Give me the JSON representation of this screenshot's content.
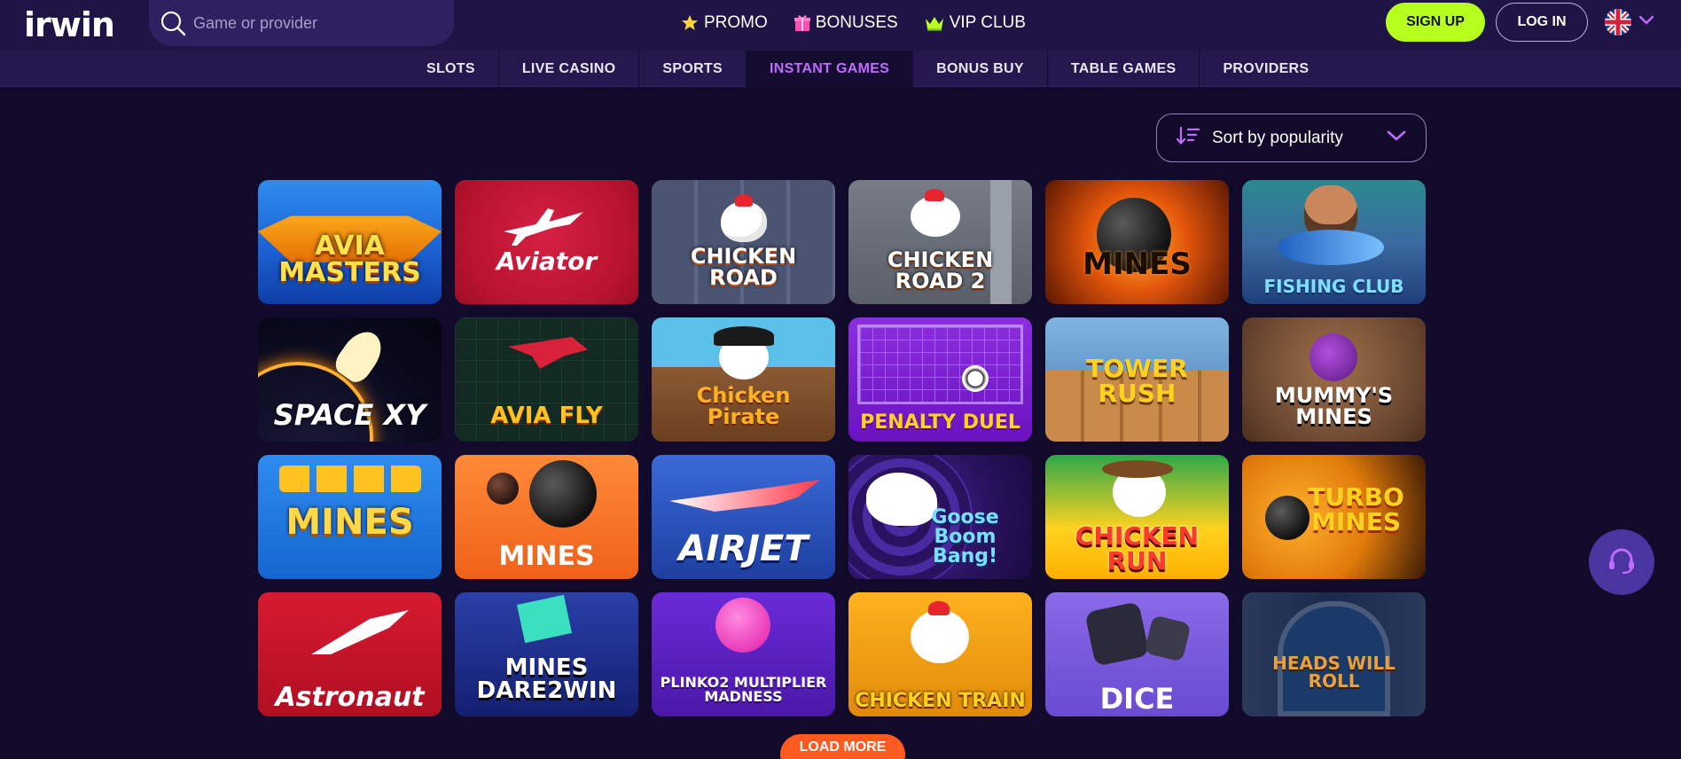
{
  "header": {
    "logo_text": "irwin",
    "search_placeholder": "Game or provider",
    "nav": [
      {
        "label": "PROMO",
        "icon": "star-icon"
      },
      {
        "label": "BONUSES",
        "icon": "gift-icon"
      },
      {
        "label": "VIP CLUB",
        "icon": "crown-icon"
      }
    ],
    "signup_label": "SIGN UP",
    "login_label": "LOG IN",
    "language_icon": "uk-flag-icon"
  },
  "categories": {
    "tabs": [
      {
        "label": "SLOTS"
      },
      {
        "label": "LIVE CASINO"
      },
      {
        "label": "SPORTS"
      },
      {
        "label": "INSTANT GAMES",
        "active": true
      },
      {
        "label": "BONUS BUY"
      },
      {
        "label": "TABLE GAMES"
      },
      {
        "label": "PROVIDERS"
      }
    ]
  },
  "sort": {
    "label": "Sort by popularity"
  },
  "games": [
    {
      "title": "AVIA MASTERS"
    },
    {
      "title": "Aviator"
    },
    {
      "title": "CHICKEN ROAD"
    },
    {
      "title": "CHICKEN ROAD 2"
    },
    {
      "title": "MINES"
    },
    {
      "title": "FISHING CLUB"
    },
    {
      "title": "SPACE XY"
    },
    {
      "title": "AVIA FLY"
    },
    {
      "title": "Chicken Pirate"
    },
    {
      "title": "PENALTY DUEL"
    },
    {
      "title": "TOWER RUSH"
    },
    {
      "title": "MUMMY'S MINES"
    },
    {
      "title": "MINES"
    },
    {
      "title": "MINES"
    },
    {
      "title": "AIRJET"
    },
    {
      "title": "Goose Boom Bang!"
    },
    {
      "title": "CHICKEN RUN"
    },
    {
      "title": "TURBO MINES"
    },
    {
      "title": "Astronaut"
    },
    {
      "title": "MINES DARE2WIN"
    },
    {
      "title": "PLINKO2 MULTIPLIER MADNESS"
    },
    {
      "title": "CHICKEN TRAIN"
    },
    {
      "title": "DICE"
    },
    {
      "title": "HEADS WILL ROLL"
    }
  ],
  "load_more_label": "LOAD MORE",
  "colors": {
    "background": "#120a2b",
    "header": "#1f1446",
    "accent_purple": "#c06cff",
    "signup_green": "#b7ff1f",
    "load_more_orange": "#ff5a1f"
  }
}
